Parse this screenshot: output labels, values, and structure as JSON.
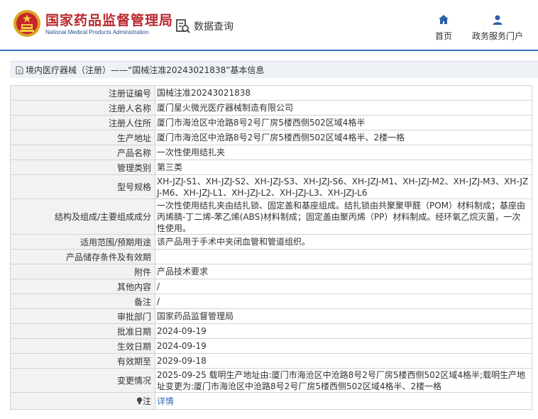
{
  "header": {
    "logo_cn": "国家药品监督管理局",
    "logo_en": "National Medical Products Administration",
    "data_query": "数据查询",
    "nav_home": "首页",
    "nav_service": "政务服务门户"
  },
  "breadcrumb": "境内医疗器械（注册）——“国械注准20243021838”基本信息",
  "colors": {
    "brand_red": "#b8282d",
    "brand_blue": "#1e4f8f",
    "link": "#2e6cb8"
  },
  "rows": [
    {
      "label": "注册证编号",
      "value": "国械注准20243021838"
    },
    {
      "label": "注册人名称",
      "value": "厦门星火微光医疗器械制造有限公司"
    },
    {
      "label": "注册人住所",
      "value": "厦门市海沧区中沧路8号2号厂房5楼西侧502区域4格半"
    },
    {
      "label": "生产地址",
      "value": "厦门市海沧区中沧路8号2号厂房5楼西侧502区域4格半、2楼一格"
    },
    {
      "label": "产品名称",
      "value": "一次性使用结扎夹"
    },
    {
      "label": "管理类别",
      "value": "第三类"
    },
    {
      "label": "型号规格",
      "value": "XH-JZJ-S1、XH-JZJ-S2、XH-JZJ-S3、XH-JZJ-S6、XH-JZJ-M1、XH-JZJ-M2、XH-JZJ-M3、XH-JZJ-M6、XH-JZJ-L1、XH-JZJ-L2、XH-JZJ-L3、XH-JZJ-L6"
    },
    {
      "label": "结构及组成/主要组成成分",
      "value": "一次性使用结扎夹由结扎锁、固定盖和基座组成。结扎锁由共聚聚甲醛（POM）材料制成；基座由丙烯腈-丁二烯-苯乙烯(ABS)材料制成；固定盖由聚丙烯（PP）材料制成。经环氧乙烷灭菌，一次性使用。"
    },
    {
      "label": "适用范围/预期用途",
      "value": "该产品用于手术中夹闭血管和管道组织。"
    },
    {
      "label": "产品储存条件及有效期",
      "value": ""
    },
    {
      "label": "附件",
      "value": "产品技术要求"
    },
    {
      "label": "其他内容",
      "value": "/"
    },
    {
      "label": "备注",
      "value": "/"
    },
    {
      "label": "审批部门",
      "value": "国家药品监督管理局"
    },
    {
      "label": "批准日期",
      "value": "2024-09-19"
    },
    {
      "label": "生效日期",
      "value": "2024-09-19"
    },
    {
      "label": "有效期至",
      "value": "2029-09-18"
    },
    {
      "label": "变更情况",
      "value": "2025-09-25 载明生产地址由:厦门市海沧区中沧路8号2号厂房5楼西侧502区域4格半;载明生产地址变更为:厦门市海沧区中沧路8号2号厂房5楼西侧502区域4格半、2楼一格"
    },
    {
      "label": "注",
      "value": "详情"
    }
  ]
}
